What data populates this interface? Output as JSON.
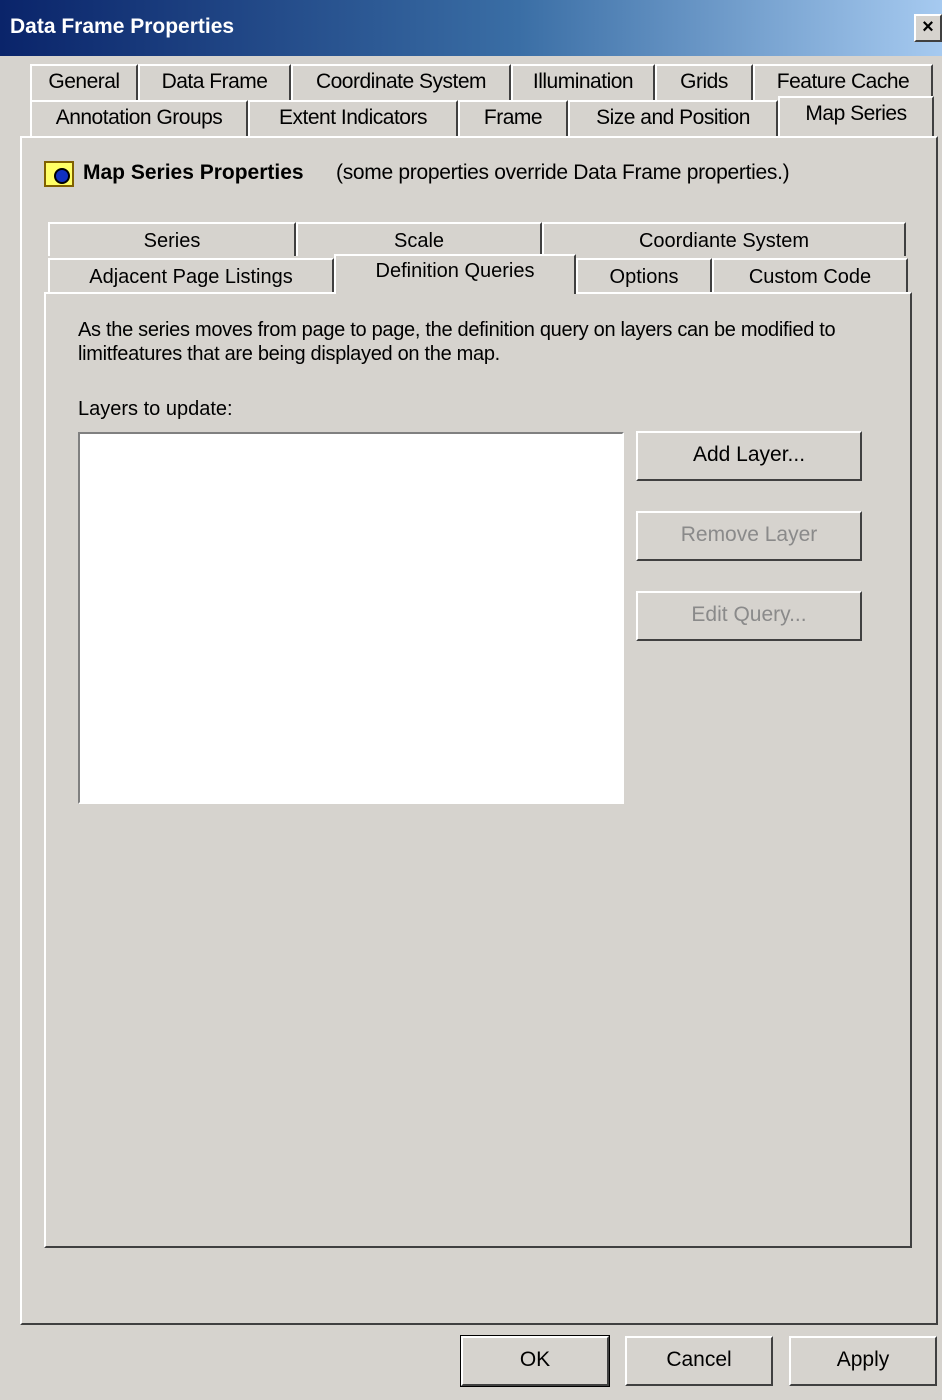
{
  "window": {
    "title": "Data Frame Properties",
    "close_label": "×"
  },
  "outer_tabs_row1": [
    "General",
    "Data Frame",
    "Coordinate System",
    "Illumination",
    "Grids",
    "Feature Cache"
  ],
  "outer_tabs_row2": [
    "Annotation Groups",
    "Extent Indicators",
    "Frame",
    "Size and Position",
    "Map Series"
  ],
  "active_outer_tab": "Map Series",
  "map_series": {
    "title": "Map Series Properties",
    "note": "(some properties override Data Frame properties.)"
  },
  "inner_tabs_row1": [
    "Series",
    "Scale",
    "Coordiante System"
  ],
  "inner_tabs_row2": [
    "Adjacent Page Listings",
    "Definition Queries",
    "Options",
    "Custom Code"
  ],
  "active_inner_tab": "Definition Queries",
  "definition_queries": {
    "description": "As the series moves from page to page, the definition query on layers can be modified to limitfeatures that are being displayed on the map.",
    "layers_label": "Layers to update:",
    "layers": [],
    "add_layer": "Add Layer...",
    "remove_layer": "Remove Layer",
    "edit_query": "Edit Query..."
  },
  "footer": {
    "ok": "OK",
    "cancel": "Cancel",
    "apply": "Apply"
  }
}
